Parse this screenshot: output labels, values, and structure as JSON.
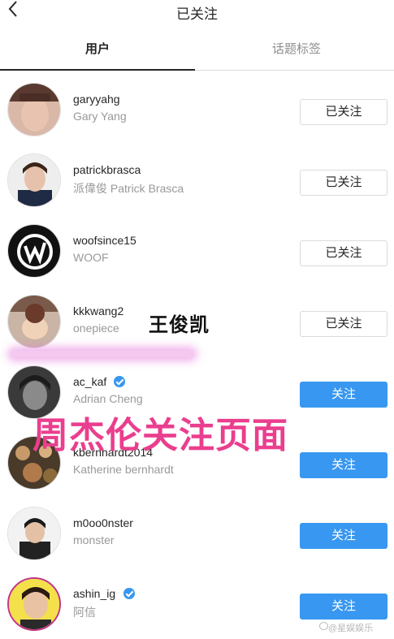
{
  "header": {
    "title": "已关注"
  },
  "tabs": [
    {
      "label": "用户",
      "active": true
    },
    {
      "label": "话题标签",
      "active": false
    }
  ],
  "users": [
    {
      "username": "garyyahg",
      "fullname": "Gary Yang",
      "verified": false,
      "button": "已关注",
      "following": true
    },
    {
      "username": "patrickbrasca",
      "fullname": "派偉俊 Patrick Brasca",
      "verified": false,
      "button": "已关注",
      "following": true
    },
    {
      "username": "woofsince15",
      "fullname": "WOOF",
      "verified": false,
      "button": "已关注",
      "following": true
    },
    {
      "username": "kkkwang2",
      "fullname": "onepiece",
      "verified": false,
      "button": "已关注",
      "following": true
    },
    {
      "username": "ac_kaf",
      "fullname": "Adrian Cheng",
      "verified": true,
      "button": "关注",
      "following": false
    },
    {
      "username": "kbernhardt2014",
      "fullname": "Katherine bernhardt",
      "verified": false,
      "button": "关注",
      "following": false
    },
    {
      "username": "m0oo0nster",
      "fullname": "monster",
      "verified": false,
      "button": "关注",
      "following": false
    },
    {
      "username": "ashin_ig",
      "fullname": "阿信",
      "verified": true,
      "button": "关注",
      "following": false
    }
  ],
  "annotations": {
    "name_label": "王俊凯",
    "caption": "周杰伦关注页面"
  },
  "watermark": {
    "text": "@星娱娱乐"
  },
  "colors": {
    "accent": "#3897f0",
    "annotation_pink": "#ea3e8e",
    "highlight_glow": "#f4c8ef"
  },
  "icons": {
    "back": "back-arrow-icon",
    "verified": "verified-badge-icon"
  }
}
